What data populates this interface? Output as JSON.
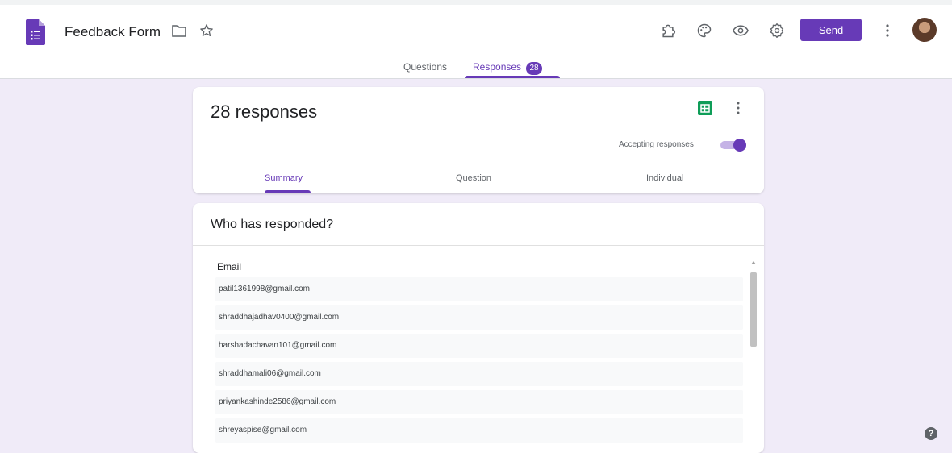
{
  "app": {
    "form_title": "Feedback Form",
    "send_label": "Send",
    "accent": "#673ab7",
    "background": "#f0ebf8",
    "header_icons": [
      "folder-icon",
      "star-icon",
      "addons-icon",
      "palette-icon",
      "preview-icon",
      "settings-icon",
      "more-vert-icon"
    ]
  },
  "tabs": {
    "questions": "Questions",
    "responses": "Responses",
    "responses_count": "28"
  },
  "summary": {
    "title": "28 responses",
    "accepting_label": "Accepting responses",
    "accepting": true,
    "subtabs": [
      "Summary",
      "Question",
      "Individual"
    ]
  },
  "who": {
    "title": "Who has responded?",
    "column_header": "Email",
    "emails": [
      "patil1361998@gmail.com",
      "shraddhajadhav0400@gmail.com",
      "harshadachavan101@gmail.com",
      "shraddhamali06@gmail.com",
      "priyankashinde2586@gmail.com",
      "shreyaspise@gmail.com"
    ]
  },
  "help": {
    "symbol": "?"
  }
}
